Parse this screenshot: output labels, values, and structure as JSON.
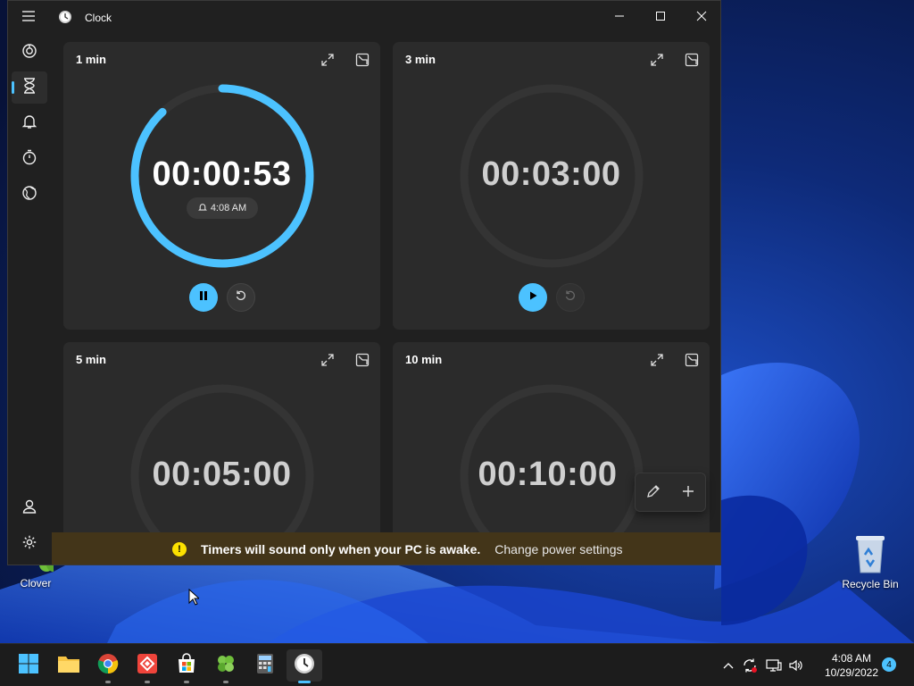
{
  "window": {
    "title": "Clock",
    "accent": "#4cc2ff"
  },
  "nav": {
    "items": [
      {
        "name": "Focus sessions",
        "icon": "focus-icon"
      },
      {
        "name": "Timer",
        "icon": "hourglass-icon",
        "active": true
      },
      {
        "name": "Alarm",
        "icon": "bell-icon"
      },
      {
        "name": "Stopwatch",
        "icon": "stopwatch-icon"
      },
      {
        "name": "World clock",
        "icon": "globe-icon"
      }
    ],
    "bottom": [
      {
        "name": "Account",
        "icon": "person-icon"
      },
      {
        "name": "Settings",
        "icon": "gear-icon"
      }
    ]
  },
  "timers": [
    {
      "label": "1 min",
      "time": "00:00:53",
      "end_time": "4:08 AM",
      "running": true,
      "progress": 0.88
    },
    {
      "label": "3 min",
      "time": "00:03:00",
      "running": false,
      "progress": 0
    },
    {
      "label": "5 min",
      "time": "00:05:00",
      "running": false,
      "progress": 0
    },
    {
      "label": "10 min",
      "time": "00:10:00",
      "running": false,
      "progress": 0
    }
  ],
  "banner": {
    "message": "Timers will sound only when your PC is awake.",
    "link": "Change power settings",
    "warn_glyph": "!"
  },
  "desktop": {
    "icons": [
      {
        "label": "Clover"
      },
      {
        "label": "Recycle Bin"
      }
    ]
  },
  "taskbar": {
    "apps": [
      "start-icon",
      "file-explorer-icon",
      "chrome-icon",
      "anydesk-icon",
      "store-icon",
      "clover-icon",
      "calculator-icon",
      "clock-app-icon"
    ],
    "time": "4:08 AM",
    "date": "10/29/2022",
    "notifications": "4"
  }
}
